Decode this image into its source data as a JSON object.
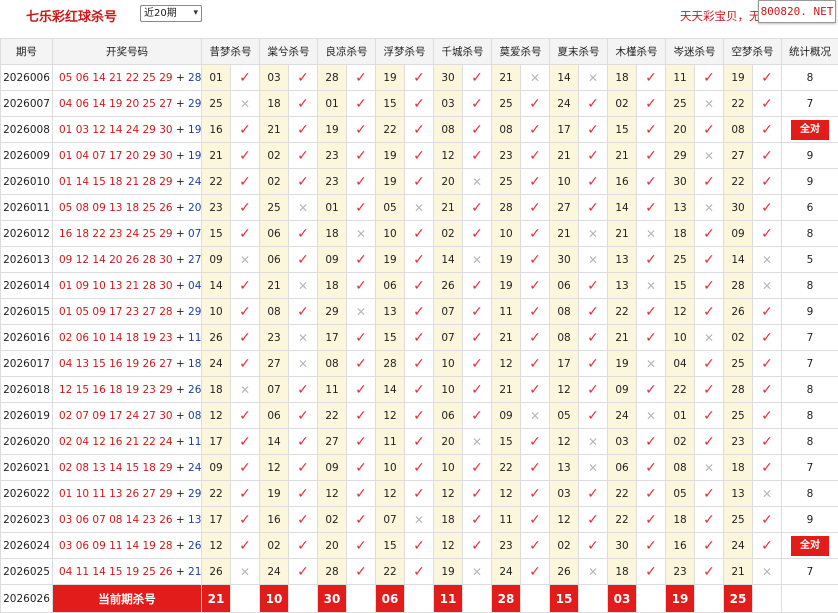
{
  "header": {
    "title": "七乐彩红球杀号",
    "period_select": "近20期",
    "ad_text": "天天彩宝贝，无",
    "site_badge": "800820. NET"
  },
  "table": {
    "col_issue": "期号",
    "col_draw": "开奖号码",
    "experts": [
      "昔梦杀号",
      "棠兮杀号",
      "良凉杀号",
      "浮梦杀号",
      "千城杀号",
      "莫爱杀号",
      "夏末杀号",
      "木槿杀号",
      "岑迷杀号",
      "空梦杀号"
    ],
    "col_stat": "统计概况",
    "rows": [
      {
        "issue": "2026006",
        "red": "05 06 14 21 22 25 29",
        "blue": "28",
        "picks": [
          "01",
          "03",
          "28",
          "19",
          "30",
          "21",
          "14",
          "18",
          "11",
          "19"
        ],
        "res": [
          1,
          1,
          1,
          1,
          1,
          0,
          0,
          1,
          1,
          1
        ],
        "stat": "8"
      },
      {
        "issue": "2026007",
        "red": "04 06 14 19 20 25 27",
        "blue": "29",
        "picks": [
          "25",
          "18",
          "01",
          "15",
          "03",
          "25",
          "24",
          "02",
          "25",
          "22"
        ],
        "res": [
          0,
          1,
          1,
          1,
          1,
          1,
          1,
          1,
          0,
          1
        ],
        "stat": "7"
      },
      {
        "issue": "2026008",
        "red": "01 03 12 14 24 29 30",
        "blue": "19",
        "picks": [
          "16",
          "21",
          "19",
          "22",
          "08",
          "08",
          "17",
          "15",
          "20",
          "08"
        ],
        "res": [
          1,
          1,
          1,
          1,
          1,
          1,
          1,
          1,
          1,
          1
        ],
        "stat": "全对"
      },
      {
        "issue": "2026009",
        "red": "01 04 07 17 20 29 30",
        "blue": "19",
        "picks": [
          "21",
          "02",
          "23",
          "19",
          "12",
          "23",
          "21",
          "21",
          "29",
          "27"
        ],
        "res": [
          1,
          1,
          1,
          1,
          1,
          1,
          1,
          1,
          0,
          1
        ],
        "stat": "9"
      },
      {
        "issue": "2026010",
        "red": "01 14 15 18 21 28 29",
        "blue": "24",
        "picks": [
          "22",
          "02",
          "23",
          "19",
          "20",
          "25",
          "10",
          "16",
          "30",
          "22"
        ],
        "res": [
          1,
          1,
          1,
          1,
          0,
          1,
          1,
          1,
          1,
          1
        ],
        "stat": "9"
      },
      {
        "issue": "2026011",
        "red": "05 08 09 13 18 25 26",
        "blue": "20",
        "picks": [
          "23",
          "25",
          "01",
          "05",
          "21",
          "28",
          "27",
          "14",
          "13",
          "30"
        ],
        "res": [
          1,
          0,
          1,
          0,
          1,
          1,
          1,
          1,
          0,
          1
        ],
        "stat": "6"
      },
      {
        "issue": "2026012",
        "red": "16 18 22 23 24 25 29",
        "blue": "07",
        "picks": [
          "15",
          "06",
          "18",
          "10",
          "02",
          "10",
          "21",
          "21",
          "18",
          "09"
        ],
        "res": [
          1,
          1,
          0,
          1,
          1,
          1,
          0,
          0,
          1,
          1
        ],
        "stat": "8"
      },
      {
        "issue": "2026013",
        "red": "09 12 14 20 26 28 30",
        "blue": "27",
        "picks": [
          "09",
          "06",
          "09",
          "19",
          "14",
          "19",
          "30",
          "13",
          "25",
          "14"
        ],
        "res": [
          0,
          1,
          1,
          1,
          0,
          1,
          0,
          1,
          1,
          0
        ],
        "stat": "5"
      },
      {
        "issue": "2026014",
        "red": "01 09 10 13 21 28 30",
        "blue": "04",
        "picks": [
          "14",
          "21",
          "18",
          "06",
          "26",
          "19",
          "06",
          "13",
          "15",
          "28"
        ],
        "res": [
          1,
          0,
          1,
          1,
          1,
          1,
          1,
          0,
          1,
          0
        ],
        "stat": "8"
      },
      {
        "issue": "2026015",
        "red": "01 05 09 17 23 27 28",
        "blue": "29",
        "picks": [
          "10",
          "08",
          "29",
          "13",
          "07",
          "11",
          "08",
          "22",
          "12",
          "26"
        ],
        "res": [
          1,
          1,
          0,
          1,
          1,
          1,
          1,
          1,
          1,
          1
        ],
        "stat": "9"
      },
      {
        "issue": "2026016",
        "red": "02 06 10 14 18 19 23",
        "blue": "11",
        "picks": [
          "26",
          "23",
          "17",
          "15",
          "07",
          "21",
          "08",
          "21",
          "10",
          "02"
        ],
        "res": [
          1,
          0,
          1,
          1,
          1,
          1,
          1,
          1,
          0,
          1
        ],
        "stat": "7"
      },
      {
        "issue": "2026017",
        "red": "04 13 15 16 19 26 27",
        "blue": "18",
        "picks": [
          "24",
          "27",
          "08",
          "28",
          "10",
          "12",
          "17",
          "19",
          "04",
          "25"
        ],
        "res": [
          1,
          0,
          1,
          1,
          1,
          1,
          1,
          0,
          1,
          1
        ],
        "stat": "7"
      },
      {
        "issue": "2026018",
        "red": "12 15 16 18 19 23 29",
        "blue": "26",
        "picks": [
          "18",
          "07",
          "11",
          "14",
          "10",
          "21",
          "12",
          "09",
          "22",
          "28"
        ],
        "res": [
          0,
          1,
          1,
          1,
          1,
          1,
          1,
          1,
          1,
          1
        ],
        "stat": "8"
      },
      {
        "issue": "2026019",
        "red": "02 07 09 17 24 27 30",
        "blue": "08",
        "picks": [
          "12",
          "06",
          "22",
          "12",
          "06",
          "09",
          "05",
          "24",
          "01",
          "25"
        ],
        "res": [
          1,
          1,
          1,
          1,
          1,
          0,
          1,
          0,
          1,
          1
        ],
        "stat": "8"
      },
      {
        "issue": "2026020",
        "red": "02 04 12 16 21 22 24",
        "blue": "11",
        "picks": [
          "17",
          "14",
          "27",
          "11",
          "20",
          "15",
          "12",
          "03",
          "02",
          "23"
        ],
        "res": [
          1,
          1,
          1,
          1,
          0,
          1,
          0,
          1,
          1,
          1
        ],
        "stat": "8"
      },
      {
        "issue": "2026021",
        "red": "02 08 13 14 15 18 29",
        "blue": "24",
        "picks": [
          "09",
          "12",
          "09",
          "10",
          "10",
          "22",
          "13",
          "06",
          "08",
          "18"
        ],
        "res": [
          1,
          1,
          1,
          1,
          1,
          1,
          0,
          1,
          0,
          1
        ],
        "stat": "7"
      },
      {
        "issue": "2026022",
        "red": "01 10 11 13 26 27 29",
        "blue": "29",
        "picks": [
          "22",
          "19",
          "12",
          "12",
          "12",
          "12",
          "03",
          "22",
          "05",
          "13"
        ],
        "res": [
          1,
          1,
          1,
          1,
          1,
          1,
          1,
          1,
          1,
          0
        ],
        "stat": "8"
      },
      {
        "issue": "2026023",
        "red": "03 06 07 08 14 23 26",
        "blue": "13",
        "picks": [
          "17",
          "16",
          "02",
          "07",
          "18",
          "11",
          "12",
          "22",
          "18",
          "25"
        ],
        "res": [
          1,
          1,
          1,
          0,
          1,
          1,
          1,
          1,
          1,
          1
        ],
        "stat": "9"
      },
      {
        "issue": "2026024",
        "red": "03 06 09 11 14 19 28",
        "blue": "26",
        "picks": [
          "12",
          "02",
          "20",
          "15",
          "12",
          "23",
          "02",
          "30",
          "16",
          "24"
        ],
        "res": [
          1,
          1,
          1,
          1,
          1,
          1,
          1,
          1,
          1,
          1
        ],
        "stat": "全对"
      },
      {
        "issue": "2026025",
        "red": "04 11 14 15 19 25 26",
        "blue": "21",
        "picks": [
          "26",
          "24",
          "28",
          "22",
          "19",
          "24",
          "26",
          "18",
          "23",
          "21"
        ],
        "res": [
          0,
          1,
          1,
          1,
          0,
          1,
          0,
          1,
          1,
          0
        ],
        "stat": "7"
      }
    ],
    "current": {
      "issue": "2026026",
      "label": "当前期杀号",
      "picks": [
        "21",
        "10",
        "30",
        "06",
        "11",
        "28",
        "15",
        "03",
        "19",
        "25"
      ]
    }
  },
  "symbols": {
    "ok": "✓",
    "bad": "✕"
  },
  "colors": {
    "accent_red": "#e21b1b",
    "pick_bg": "#fbf6dc",
    "blue_ball": "#1d3f9c",
    "ok_mark": "#e0303a",
    "bad_mark": "#b8b8b8"
  }
}
